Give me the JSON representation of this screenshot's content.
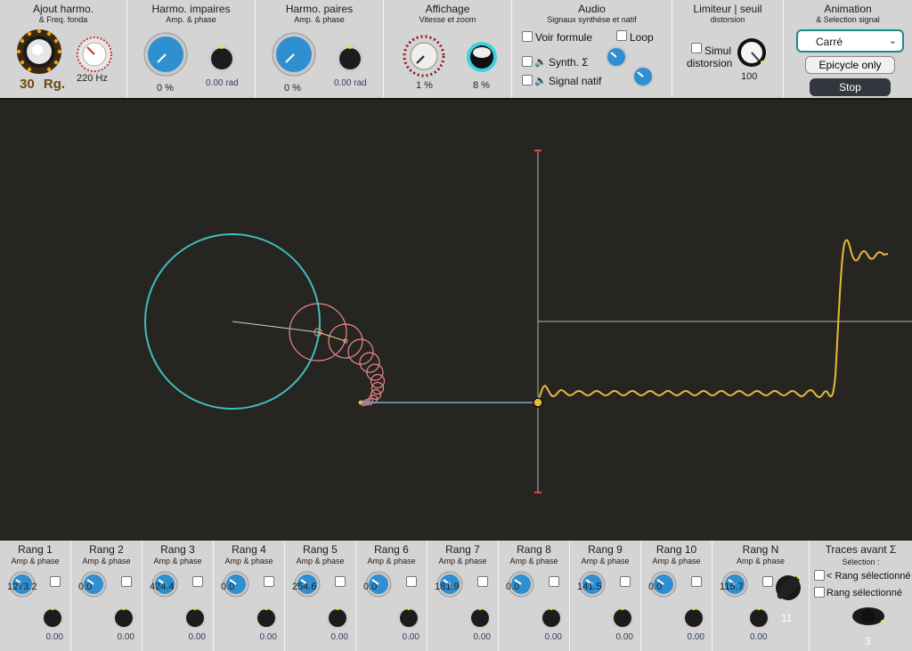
{
  "harmonics_add": {
    "title": "Ajout harmo.",
    "subtitle": "& Freq. fonda",
    "rank_count": "30",
    "rank_unit": "Rg.",
    "frequency": "220 Hz"
  },
  "odd_harmonics": {
    "title": "Harmo. impaires",
    "subtitle": "Amp. & phase",
    "amplitude": "0 %",
    "phase": "0.00 rad"
  },
  "even_harmonics": {
    "title": "Harmo. paires",
    "subtitle": "Amp. & phase",
    "amplitude": "0 %",
    "phase": "0.00 rad"
  },
  "display": {
    "title": "Affichage",
    "subtitle": "Vitesse et zoom",
    "speed": "1 %",
    "zoom": "8 %"
  },
  "audio": {
    "title": "Audio",
    "subtitle": "Signaux synthèse et natif",
    "show_formula": "Voir formule",
    "loop": "Loop",
    "synth": "Synth. Σ",
    "native": "Signal natif",
    "speaker_icon": "speaker-icon"
  },
  "limiter": {
    "title": "Limiteur | seuil",
    "subtitle": "distorsion",
    "simul_line1": "Simul",
    "simul_line2": "distorsion",
    "threshold": "100"
  },
  "animation": {
    "title": "Animation",
    "subtitle": "& Selection signal",
    "signal_selected": "Carré",
    "epicycle_button": "Epicycle only",
    "stop_button": "Stop"
  },
  "ranks": [
    {
      "title": "Rang 1",
      "subtitle": "Amp & phase",
      "amp": "1273.2",
      "phase": "0.00"
    },
    {
      "title": "Rang 2",
      "subtitle": "Amp & phase",
      "amp": "0.0",
      "phase": "0.00"
    },
    {
      "title": "Rang 3",
      "subtitle": "Amp & phase",
      "amp": "424.4",
      "phase": "0.00"
    },
    {
      "title": "Rang 4",
      "subtitle": "Amp & phase",
      "amp": "0.0",
      "phase": "0.00"
    },
    {
      "title": "Rang 5",
      "subtitle": "Amp & phase",
      "amp": "254.6",
      "phase": "0.00"
    },
    {
      "title": "Rang 6",
      "subtitle": "Amp & phase",
      "amp": "0.0",
      "phase": "0.00"
    },
    {
      "title": "Rang 7",
      "subtitle": "Amp & phase",
      "amp": "181.9",
      "phase": "0.00"
    },
    {
      "title": "Rang 8",
      "subtitle": "Amp & phase",
      "amp": "0.0",
      "phase": "0.00"
    },
    {
      "title": "Rang 9",
      "subtitle": "Amp & phase",
      "amp": "141.5",
      "phase": "0.00"
    },
    {
      "title": "Rang 10",
      "subtitle": "Amp & phase",
      "amp": "0.0",
      "phase": "0.00"
    }
  ],
  "rank_n": {
    "title": "Rang N",
    "subtitle": "Amp & phase",
    "amp": "115.7",
    "phase": "0.00",
    "n": "11"
  },
  "traces": {
    "title": "Traces avant Σ",
    "subtitle": "Sélection :",
    "opt1": "< Rang sélectionné",
    "opt2": "Rang sélectionné",
    "value": "3"
  },
  "colors": {
    "teal": "#3fbfbf",
    "salmon": "#e98a8a",
    "gold": "#e8b93a",
    "knob_blue": "#2f8fd0",
    "axis": "#b5b5b5",
    "red_tick": "#e04a3a"
  }
}
